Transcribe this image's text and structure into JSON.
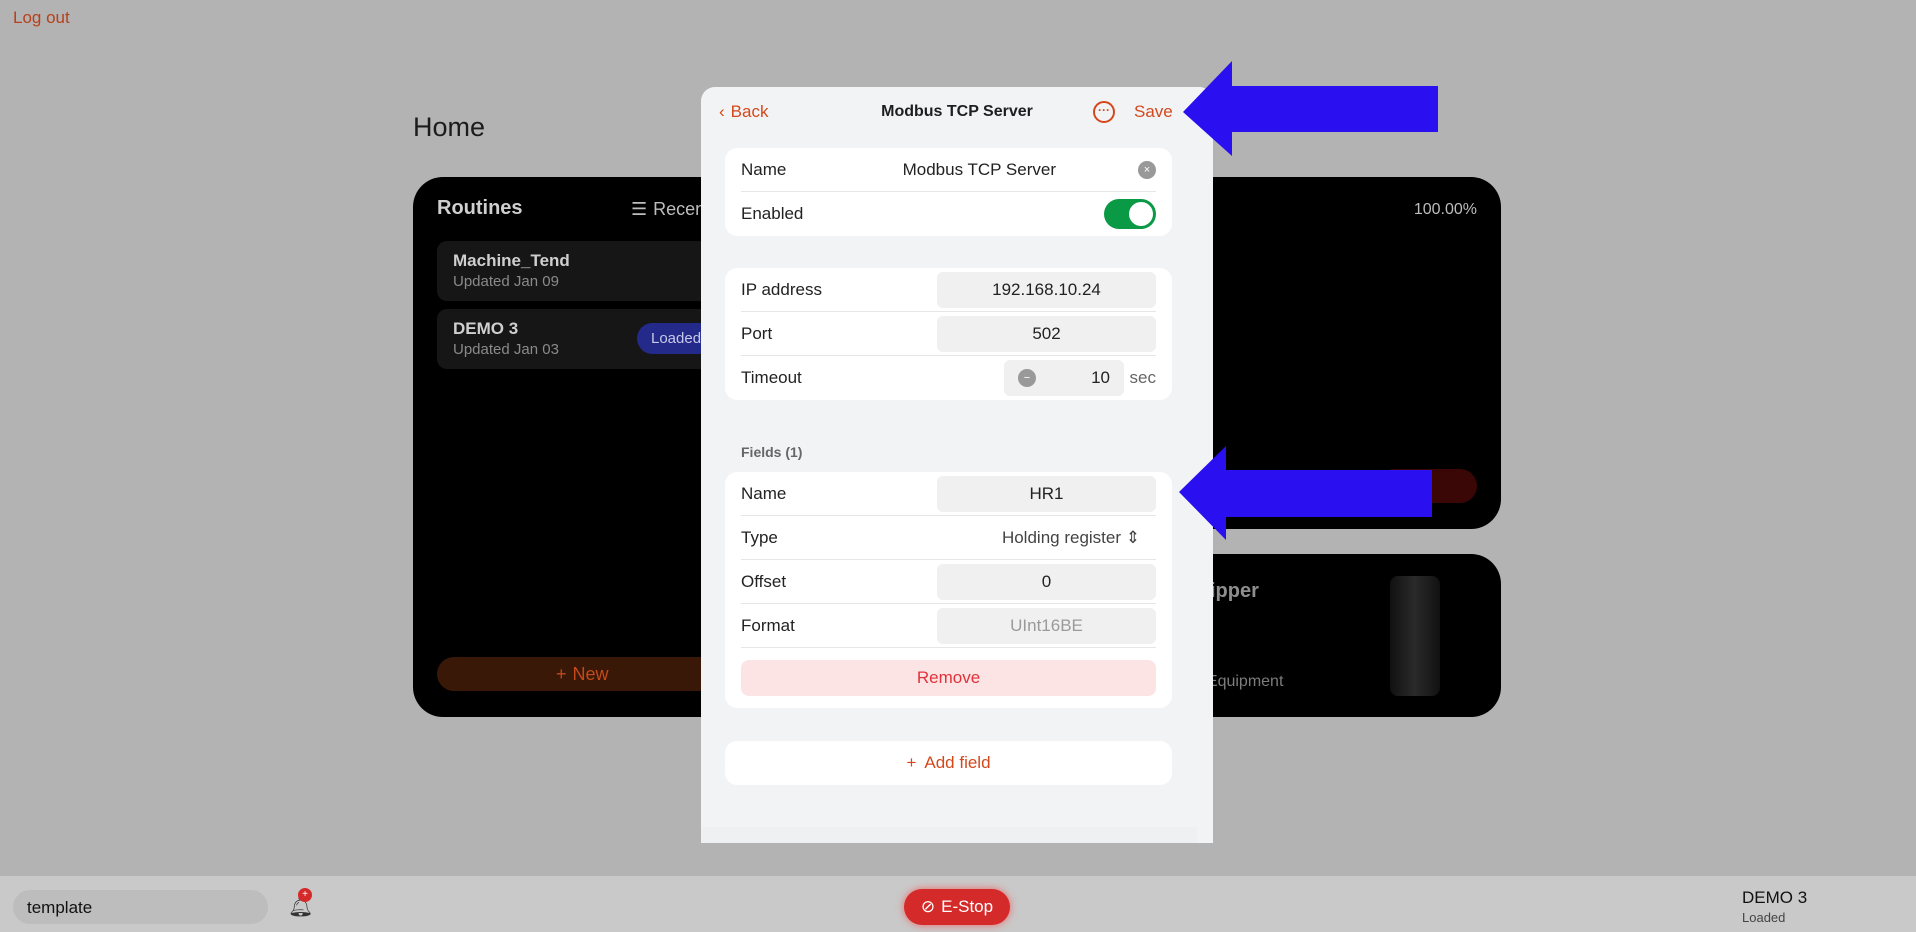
{
  "top": {
    "logout": "Log out",
    "home_title": "Home"
  },
  "routines": {
    "title": "Routines",
    "sort": "Recent",
    "items": [
      {
        "name": "Machine_Tend",
        "updated": "Updated Jan 09"
      },
      {
        "name": "DEMO 3",
        "updated": "Updated Jan 03",
        "badge": "Loaded"
      }
    ],
    "new_label": "New"
  },
  "robot": {
    "percent": "100.00%"
  },
  "gripper": {
    "title": "gripper",
    "subtitle": "in Equipment"
  },
  "modal": {
    "back": "Back",
    "title": "Modbus TCP Server",
    "save": "Save",
    "general": {
      "name_label": "Name",
      "name_value": "Modbus TCP Server",
      "enabled_label": "Enabled",
      "enabled": true
    },
    "connection": {
      "ip_label": "IP address",
      "ip_value": "192.168.10.24",
      "port_label": "Port",
      "port_value": "502",
      "timeout_label": "Timeout",
      "timeout_value": "10",
      "timeout_unit": "sec"
    },
    "fields_header": "Fields (1)",
    "field": {
      "name_label": "Name",
      "name_value": "HR1",
      "type_label": "Type",
      "type_value": "Holding register",
      "offset_label": "Offset",
      "offset_value": "0",
      "format_label": "Format",
      "format_value": "UInt16BE",
      "remove": "Remove"
    },
    "add_field": "Add field"
  },
  "bottom": {
    "template": "template",
    "estop": "E-Stop",
    "routine": "DEMO 3",
    "status": "Loaded"
  },
  "colors": {
    "accent": "#d4481c",
    "arrow": "#2a0ff0",
    "toggle_on": "#0a9a45",
    "estop": "#d42a2a"
  }
}
